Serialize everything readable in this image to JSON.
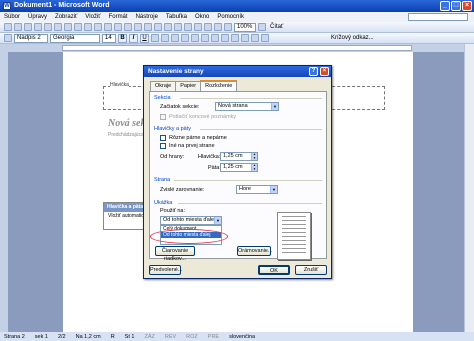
{
  "window": {
    "title": "Dokument1 - Microsoft Word"
  },
  "menu": [
    "Súbor",
    "Úpravy",
    "Zobraziť",
    "Vložiť",
    "Formát",
    "Nástroje",
    "Tabuľka",
    "Okno",
    "Pomocník"
  ],
  "toolbar": {
    "style_value": "Nadpis 2",
    "font_value": "Georgia",
    "size_value": "14",
    "zoom_value": "100%",
    "read_label": "Čítať",
    "extra_label": "Krížový odkaz..."
  },
  "document": {
    "header_label": "Hlavička",
    "section_heading": "Nová sekcia",
    "section_text": "Predchádzajúca",
    "hf_toolbar_title": "Hlavička a päta",
    "hf_toolbar_item": "Vložiť automaticky"
  },
  "dialog": {
    "title": "Nastavenie strany",
    "tabs": [
      "Okraje",
      "Papier",
      "Rozloženie"
    ],
    "section": {
      "group": "Sekcia",
      "start_label": "Začiatok sekcie:",
      "start_value": "Nová strana",
      "suppress_endnotes": "Potlačiť koncové poznámky"
    },
    "headers": {
      "group": "Hlavičky a päty",
      "odd_even": "Rôzne párne a nepárne",
      "first_page": "Iné na prvej strane",
      "from_edge": "Od hrany:",
      "header_label": "Hlavička:",
      "header_value": "1,25 cm",
      "footer_label": "Päta:",
      "footer_value": "1,25 cm"
    },
    "page": {
      "group": "Strana",
      "valign_label": "Zvislé zarovnanie:",
      "valign_value": "Hore"
    },
    "preview": {
      "group": "Ukážka",
      "apply_label": "Použiť na:",
      "apply_value": "Od tohto miesta ďalej",
      "options": [
        "Celý dokument",
        "Od tohto miesta ďalej"
      ]
    },
    "line_numbers": "Čiarovanie riadkov...",
    "borders": "Orámovanie...",
    "default": "Predvolené...",
    "ok": "OK",
    "cancel": "Zrušiť"
  },
  "status": {
    "page": "Strana 2",
    "section": "sek 1",
    "pages": "2/2",
    "at": "Na 1,2 cm",
    "line": "R",
    "col": "St 1",
    "rec": "ZÁZ",
    "trk": "REV",
    "ext": "ROZ",
    "ovr": "PRE",
    "lang": "slovenčina"
  }
}
